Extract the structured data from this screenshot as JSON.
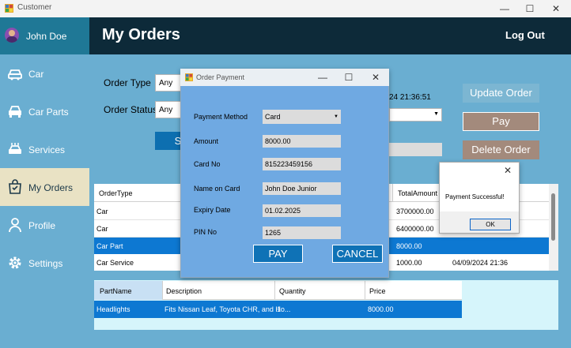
{
  "window": {
    "title": "Customer",
    "minimize": "—",
    "maximize": "☐",
    "close": "✕"
  },
  "user": {
    "name": "John Doe"
  },
  "header": {
    "title": "My Orders",
    "logout": "Log Out"
  },
  "sidebar": {
    "items": [
      {
        "label": "Car",
        "icon": "car-icon"
      },
      {
        "label": "Car Parts",
        "icon": "car-front-icon"
      },
      {
        "label": "Services",
        "icon": "car-service-icon"
      },
      {
        "label": "My Orders",
        "icon": "bag-icon"
      },
      {
        "label": "Profile",
        "icon": "person-icon"
      },
      {
        "label": "Settings",
        "icon": "gear-icon"
      }
    ]
  },
  "filters": {
    "order_type_label": "Order Type",
    "order_type_value": "Any",
    "order_status_label": "Order Status",
    "order_status_value": "Any",
    "search_partial": "S",
    "date_partial": "24 21:36:51"
  },
  "actions": {
    "update": "Update Order",
    "pay": "Pay",
    "delete": "Delete Order"
  },
  "orders_grid": {
    "headers": {
      "type": "OrderType",
      "total": "TotalAmount"
    },
    "rows": [
      {
        "type": "Car",
        "total": "3700000.00",
        "date": ""
      },
      {
        "type": "Car",
        "total": "6400000.00",
        "date": ""
      },
      {
        "type": "Car Part",
        "total": "8000.00",
        "date": ""
      },
      {
        "type": "Car Service",
        "total": "1000.00",
        "date": "04/09/2024 21:36"
      }
    ]
  },
  "parts_grid": {
    "headers": {
      "name": "PartName",
      "description": "Description",
      "quantity": "Quantity",
      "price": "Price"
    },
    "rows": [
      {
        "name": "Headlights",
        "description": "Fits Nissan Leaf, Toyota CHR, and Ho...",
        "quantity": "1",
        "price": "8000.00"
      }
    ]
  },
  "payment_dialog": {
    "title": "Order Payment",
    "method_label": "Payment Method",
    "method_value": "Card",
    "amount_label": "Amount",
    "amount_value": "8000.00",
    "card_label": "Card No",
    "card_value": "815223459156",
    "name_label": "Name on Card",
    "name_value": "John Doe Junior",
    "expiry_label": "Expiry Date",
    "expiry_value": "01.02.2025",
    "pin_label": "PIN No",
    "pin_value": "1265",
    "pay_button": "PAY",
    "cancel_button": "CANCEL"
  },
  "message_box": {
    "text": "Payment Successful!",
    "ok": "OK",
    "close": "✕"
  }
}
